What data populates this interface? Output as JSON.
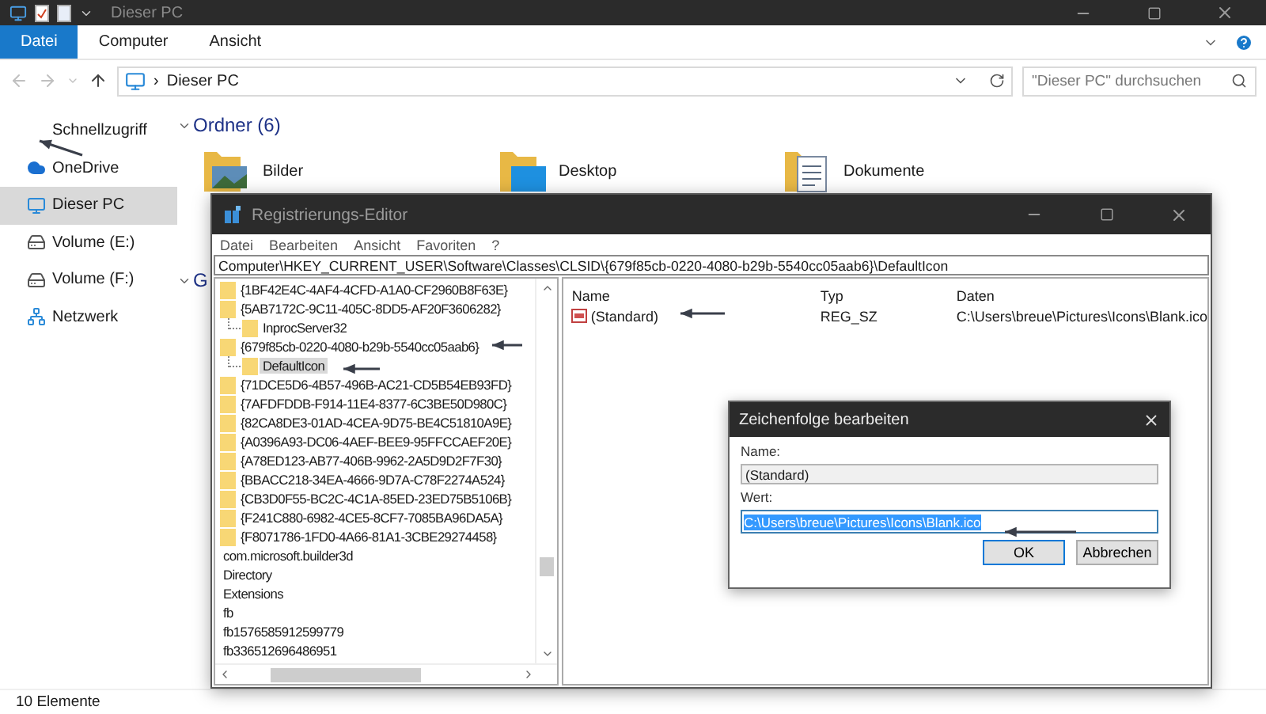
{
  "explorer": {
    "title": "Dieser PC",
    "ribbon_tabs": [
      {
        "label": "Datei",
        "selected": true
      },
      {
        "label": "Computer",
        "selected": false
      },
      {
        "label": "Ansicht",
        "selected": false
      }
    ],
    "address": {
      "separator": "›",
      "location": "Dieser PC"
    },
    "search": {
      "placeholder": "\"Dieser PC\" durchsuchen"
    },
    "nav_items": [
      {
        "label": "Schnellzugriff",
        "kind": "plain",
        "selected": false
      },
      {
        "label": "OneDrive",
        "kind": "cloud",
        "selected": false
      },
      {
        "label": "Dieser PC",
        "kind": "computer",
        "selected": true
      },
      {
        "label": "Volume (E:)",
        "kind": "drive",
        "selected": false
      },
      {
        "label": "Volume (F:)",
        "kind": "drive",
        "selected": false
      },
      {
        "label": "Netzwerk",
        "kind": "network",
        "selected": false
      }
    ],
    "groups": [
      {
        "heading": "Ordner (6)",
        "items": [
          {
            "label": "Bilder",
            "kind": "pictures"
          },
          {
            "label": "Desktop",
            "kind": "desktop"
          },
          {
            "label": "Dokumente",
            "kind": "documents"
          }
        ]
      },
      {
        "heading": "G"
      }
    ],
    "status": "10 Elemente"
  },
  "registry": {
    "title": "Registrierungs-Editor",
    "menu": [
      "Datei",
      "Bearbeiten",
      "Ansicht",
      "Favoriten",
      "?"
    ],
    "path": "Computer\\HKEY_CURRENT_USER\\Software\\Classes\\CLSID\\{679f85cb-0220-4080-b29b-5540cc05aab6}\\DefaultIcon",
    "tree": [
      {
        "label": "{1BF42E4C-4AF4-4CFD-A1A0-CF2960B8F63E}",
        "kind": "folder",
        "selected": false
      },
      {
        "label": "{5AB7172C-9C11-405C-8DD5-AF20F3606282}",
        "kind": "folder",
        "selected": false,
        "children": [
          {
            "label": "InprocServer32",
            "kind": "folder",
            "selected": false
          }
        ]
      },
      {
        "label": "{679f85cb-0220-4080-b29b-5540cc05aab6}",
        "kind": "folder",
        "selected": false,
        "children": [
          {
            "label": "DefaultIcon",
            "kind": "folder",
            "selected": true
          }
        ]
      },
      {
        "label": "{71DCE5D6-4B57-496B-AC21-CD5B54EB93FD}",
        "kind": "folder",
        "selected": false
      },
      {
        "label": "{7AFDFDDB-F914-11E4-8377-6C3BE50D980C}",
        "kind": "folder",
        "selected": false
      },
      {
        "label": "{82CA8DE3-01AD-4CEA-9D75-BE4C51810A9E}",
        "kind": "folder",
        "selected": false
      },
      {
        "label": "{A0396A93-DC06-4AEF-BEE9-95FFCCAEF20E}",
        "kind": "folder",
        "selected": false
      },
      {
        "label": "{A78ED123-AB77-406B-9962-2A5D9D2F7F30}",
        "kind": "folder",
        "selected": false
      },
      {
        "label": "{BBACC218-34EA-4666-9D7A-C78F2274A524}",
        "kind": "folder",
        "selected": false
      },
      {
        "label": "{CB3D0F55-BC2C-4C1A-85ED-23ED75B5106B}",
        "kind": "folder",
        "selected": false
      },
      {
        "label": "{F241C880-6982-4CE5-8CF7-7085BA96DA5A}",
        "kind": "folder",
        "selected": false
      },
      {
        "label": "{F8071786-1FD0-4A66-81A1-3CBE29274458}",
        "kind": "folder",
        "selected": false
      },
      {
        "label": "com.microsoft.builder3d",
        "kind": "plain",
        "selected": false
      },
      {
        "label": "Directory",
        "kind": "plain",
        "selected": false
      },
      {
        "label": "Extensions",
        "kind": "plain",
        "selected": false
      },
      {
        "label": "fb",
        "kind": "plain",
        "selected": false
      },
      {
        "label": "fb1576585912599779",
        "kind": "plain",
        "selected": false
      },
      {
        "label": "fb336512696486951",
        "kind": "plain",
        "selected": false
      }
    ],
    "columns": [
      "Name",
      "Typ",
      "Daten"
    ],
    "values": [
      {
        "name": "(Standard)",
        "type": "REG_SZ",
        "data": "C:\\Users\\breue\\Pictures\\Icons\\Blank.ico"
      }
    ]
  },
  "dialog": {
    "title": "Zeichenfolge bearbeiten",
    "name_label": "Name:",
    "name_value": "(Standard)",
    "value_label": "Wert:",
    "value": "C:\\Users\\breue\\Pictures\\Icons\\Blank.ico",
    "buttons": [
      {
        "label": "OK",
        "default": true
      },
      {
        "label": "Abbrechen",
        "default": false
      }
    ]
  }
}
